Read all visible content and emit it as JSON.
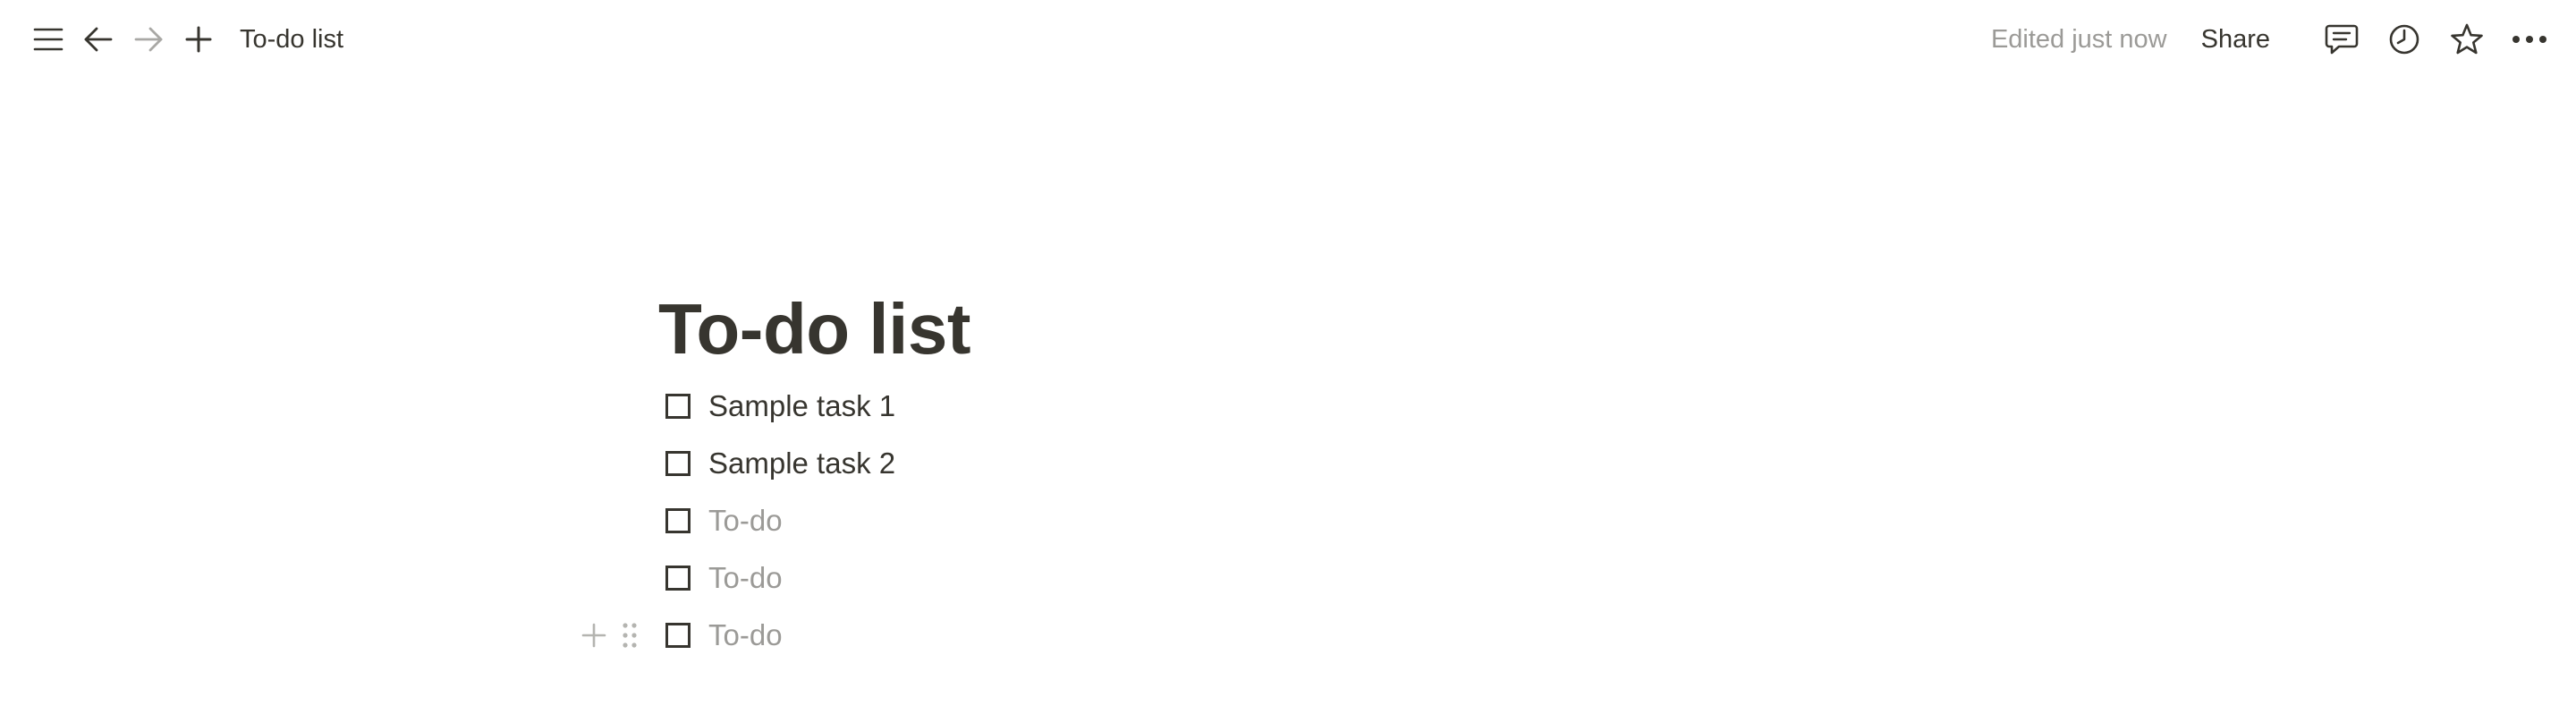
{
  "topbar": {
    "menu_icon": "hamburger-menu-icon",
    "back_icon": "arrow-left-icon",
    "forward_icon": "arrow-right-icon",
    "new_page_icon": "plus-icon",
    "breadcrumb": "To-do list",
    "edited_status": "Edited just now",
    "share_label": "Share",
    "comments_icon": "comment-icon",
    "history_icon": "clock-icon",
    "favorite_icon": "star-icon",
    "more_icon": "more-horizontal-icon"
  },
  "page": {
    "title": "To-do list",
    "todos": [
      {
        "text": "Sample task 1",
        "checked": false,
        "placeholder": false
      },
      {
        "text": "Sample task 2",
        "checked": false,
        "placeholder": false
      },
      {
        "text": "To-do",
        "checked": false,
        "placeholder": true
      },
      {
        "text": "To-do",
        "checked": false,
        "placeholder": true
      },
      {
        "text": "To-do",
        "checked": false,
        "placeholder": true
      }
    ]
  },
  "colors": {
    "text": "#37352f",
    "muted": "#9b9a97",
    "handle": "#b4b4b0",
    "background": "#ffffff"
  }
}
